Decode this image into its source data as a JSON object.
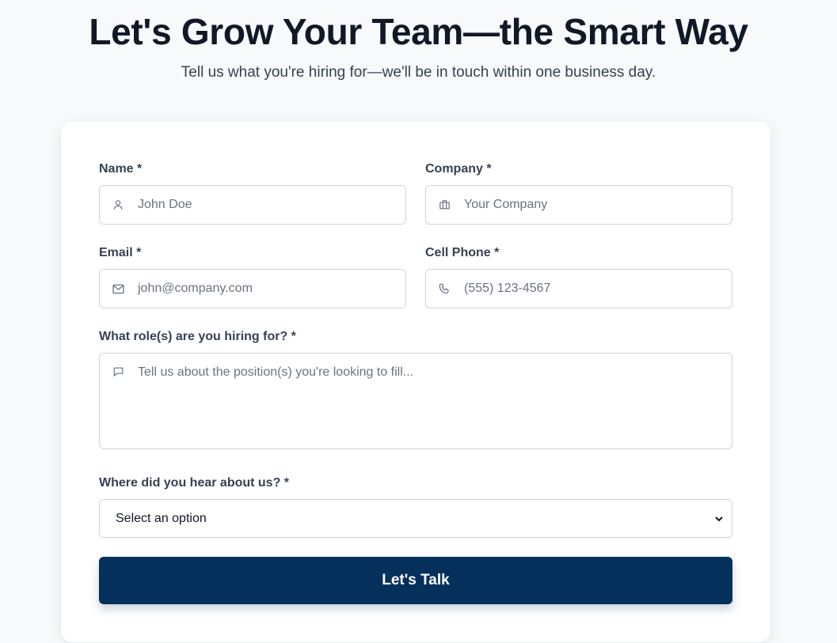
{
  "header": {
    "title": "Let's Grow Your Team—the Smart Way",
    "subtitle": "Tell us what you're hiring for—we'll be in touch within one business day."
  },
  "form": {
    "name": {
      "label": "Name *",
      "placeholder": "John Doe",
      "value": "",
      "icon": "user-icon"
    },
    "company": {
      "label": "Company *",
      "placeholder": "Your Company",
      "value": "",
      "icon": "briefcase-icon"
    },
    "email": {
      "label": "Email *",
      "placeholder": "john@company.com",
      "value": "",
      "icon": "mail-icon"
    },
    "phone": {
      "label": "Cell Phone *",
      "placeholder": "(555) 123-4567",
      "value": "",
      "icon": "phone-icon"
    },
    "roles": {
      "label": "What role(s) are you hiring for? *",
      "placeholder": "Tell us about the position(s) you're looking to fill...",
      "value": "",
      "icon": "message-icon"
    },
    "source": {
      "label": "Where did you hear about us? *",
      "selected": "Select an option",
      "icon": "chevron-down-icon"
    },
    "submit_label": "Let's Talk"
  },
  "colors": {
    "background": "#f8f9fb",
    "card": "#ffffff",
    "primary_button": "#05305c",
    "border": "#cfd4dc",
    "placeholder_text": "#6b7280"
  }
}
